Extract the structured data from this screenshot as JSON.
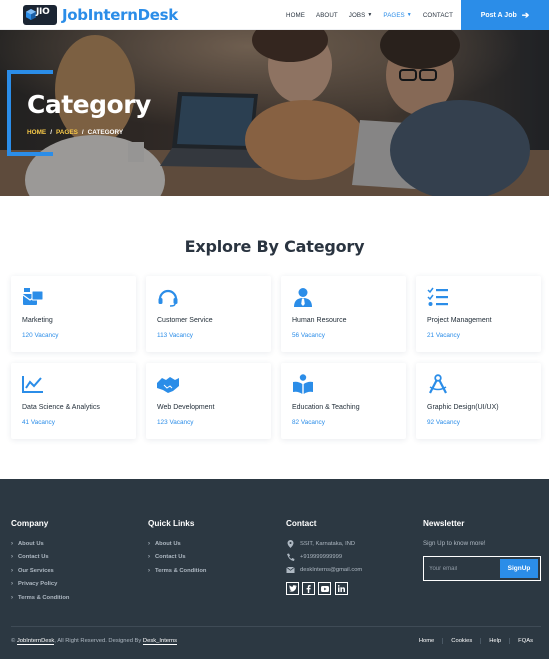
{
  "brand": {
    "logo_text": "JIO",
    "name": "JobInternDesk"
  },
  "nav": {
    "items": [
      {
        "label": "HOME"
      },
      {
        "label": "ABOUT"
      },
      {
        "label": "JOBS"
      },
      {
        "label": "PAGES"
      },
      {
        "label": "CONTACT"
      }
    ],
    "post_job": "Post A Job"
  },
  "hero": {
    "title": "Category",
    "breadcrumb": {
      "home": "HOME",
      "pages": "PAGES",
      "current": "CATEGORY",
      "separator": "/"
    }
  },
  "section": {
    "title": "Explore By Category"
  },
  "categories": [
    {
      "name": "Marketing",
      "count": "120 Vacancy",
      "icon": "envelope-open-icon"
    },
    {
      "name": "Customer Service",
      "count": "113 Vacancy",
      "icon": "headset-icon"
    },
    {
      "name": "Human Resource",
      "count": "56 Vacancy",
      "icon": "user-tie-icon"
    },
    {
      "name": "Project Management",
      "count": "21 Vacancy",
      "icon": "tasks-icon"
    },
    {
      "name": "Data Science & Analytics",
      "count": "41 Vacancy",
      "icon": "chart-line-icon"
    },
    {
      "name": "Web Development",
      "count": "123 Vacancy",
      "icon": "handshake-icon"
    },
    {
      "name": "Education & Teaching",
      "count": "82 Vacancy",
      "icon": "book-reader-icon"
    },
    {
      "name": "Graphic Design(UI/UX)",
      "count": "92 Vacancy",
      "icon": "drafting-compass-icon"
    }
  ],
  "footer": {
    "company": {
      "title": "Company",
      "links": [
        "About Us",
        "Contact Us",
        "Our Services",
        "Privacy Policy",
        "Terms & Condition"
      ]
    },
    "quick_links": {
      "title": "Quick Links",
      "links": [
        "About Us",
        "Contact Us",
        "Terms & Condition"
      ]
    },
    "contact": {
      "title": "Contact",
      "address": "SSIT, Karnataka, IND",
      "phone": "+919999999999",
      "email": "deskInterns@gmail.com"
    },
    "social": [
      "twitter-icon",
      "facebook-icon",
      "youtube-icon",
      "linkedin-icon"
    ],
    "newsletter": {
      "title": "Newsletter",
      "subtitle": "Sign Up to know more!",
      "placeholder": "Your email",
      "button": "SignUp"
    },
    "copyright": {
      "prefix": "©",
      "brand": "JobInternDesk",
      "middle": ", All Right Reserved. Designed By",
      "designer": "Desk_Interns"
    },
    "bottom_links": [
      "Home",
      "Cookies",
      "Help",
      "FQAs"
    ]
  },
  "colors": {
    "accent": "#2b8de8",
    "footer_bg": "#2c3842",
    "breadcrumb_link": "#f7c948"
  }
}
